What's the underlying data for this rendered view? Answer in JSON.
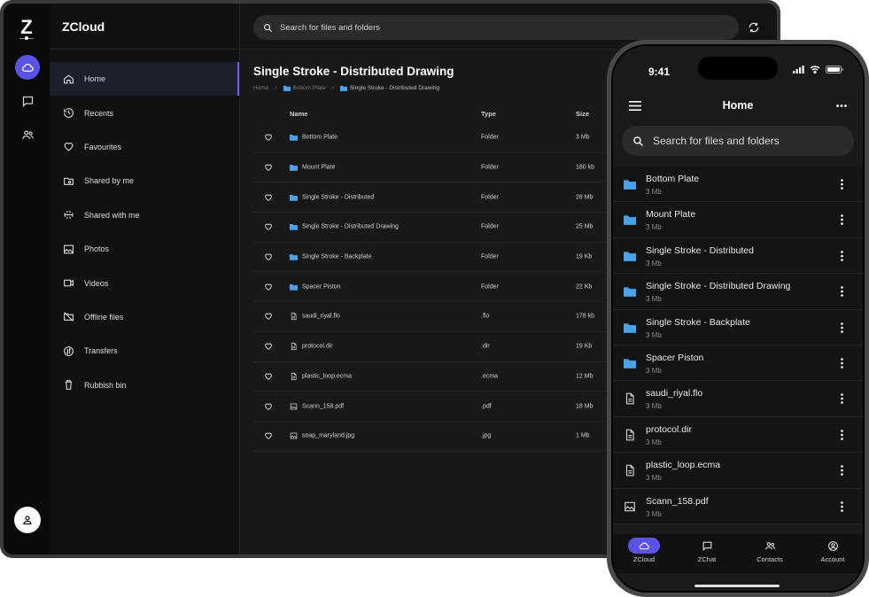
{
  "rail": {
    "logo": "Z"
  },
  "sidebar": {
    "brand": "ZCloud",
    "items": [
      {
        "label": "Home",
        "icon": "home-icon"
      },
      {
        "label": "Recents",
        "icon": "history-icon"
      },
      {
        "label": "Favourites",
        "icon": "heart-icon"
      },
      {
        "label": "Shared by me",
        "icon": "shared-folder-icon"
      },
      {
        "label": "Shared with me",
        "icon": "share-arrows-icon"
      },
      {
        "label": "Photos",
        "icon": "image-icon"
      },
      {
        "label": "Videos",
        "icon": "video-icon"
      },
      {
        "label": "Offline files",
        "icon": "offline-icon"
      },
      {
        "label": "Transfers",
        "icon": "transfer-icon"
      },
      {
        "label": "Rubbish bin",
        "icon": "trash-icon"
      }
    ]
  },
  "search": {
    "placeholder": "Search for files and folders"
  },
  "main": {
    "title": "Single Stroke - Distributed Drawing",
    "breadcrumb": {
      "home": "Home",
      "level1": "Bottom Plate",
      "level2": "Single Stroke - Distributed Drawing"
    },
    "columns": {
      "name": "Name",
      "type": "Type",
      "size": "Size"
    },
    "files": [
      {
        "name": "Bottom Plate",
        "type": "Folder",
        "size": "3 Mb",
        "kind": "folder"
      },
      {
        "name": "Mount Plate",
        "type": "Folder",
        "size": "180 kb",
        "kind": "folder"
      },
      {
        "name": "Single Stroke - Distributed",
        "type": "Folder",
        "size": "26 Mb",
        "kind": "folder"
      },
      {
        "name": "Single Stroke - Distributed Drawing",
        "type": "Folder",
        "size": "25 Mb",
        "kind": "folder"
      },
      {
        "name": "Single Stroke - Backplate",
        "type": "Folder",
        "size": "19 Kb",
        "kind": "folder"
      },
      {
        "name": "Spacer Piston",
        "type": "Folder",
        "size": "22 Kb",
        "kind": "folder"
      },
      {
        "name": "saudi_riyal.flo",
        "type": ".flo",
        "size": "178 kb",
        "kind": "doc"
      },
      {
        "name": "protocol.dir",
        "type": ".dir",
        "size": "19 Kb",
        "kind": "doc"
      },
      {
        "name": "plastic_loop.ecma",
        "type": ".ecma",
        "size": "12 Mb",
        "kind": "doc"
      },
      {
        "name": "Scann_158.pdf",
        "type": ".pdf",
        "size": "18 Mb",
        "kind": "image"
      },
      {
        "name": "soap_maryland.jpg",
        "type": ".jpg",
        "size": "1 Mb",
        "kind": "image"
      }
    ]
  },
  "phone": {
    "time": "9:41",
    "title": "Home",
    "search_placeholder": "Search for files and folders",
    "files": [
      {
        "name": "Bottom Plate",
        "size": "3 Mb",
        "kind": "folder"
      },
      {
        "name": "Mount Plate",
        "size": "3 Mb",
        "kind": "folder"
      },
      {
        "name": "Single Stroke - Distributed",
        "size": "3 Mb",
        "kind": "folder"
      },
      {
        "name": "Single Stroke - Distributed Drawing",
        "size": "3 Mb",
        "kind": "folder"
      },
      {
        "name": "Single Stroke - Backplate",
        "size": "3 Mb",
        "kind": "folder"
      },
      {
        "name": "Spacer Piston",
        "size": "3 Mb",
        "kind": "folder"
      },
      {
        "name": "saudi_riyal.flo",
        "size": "3 Mb",
        "kind": "doc"
      },
      {
        "name": "protocol.dir",
        "size": "3 Mb",
        "kind": "doc"
      },
      {
        "name": "plastic_loop.ecma",
        "size": "3 Mb",
        "kind": "doc"
      },
      {
        "name": "Scann_158.pdf",
        "size": "3 Mb",
        "kind": "image"
      }
    ],
    "tabs": [
      {
        "label": "ZCloud",
        "icon": "cloud-icon"
      },
      {
        "label": "ZChat",
        "icon": "chat-icon"
      },
      {
        "label": "Contacts",
        "icon": "contacts-icon"
      },
      {
        "label": "Account",
        "icon": "account-icon"
      }
    ]
  },
  "colors": {
    "accent": "#5b52e6",
    "folder": "#4aa3e8",
    "background": "#161616"
  }
}
